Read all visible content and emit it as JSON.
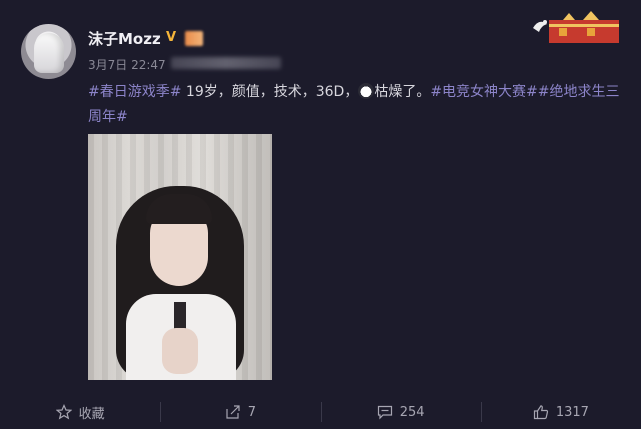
{
  "author": {
    "name": "沫子Mozz",
    "verified_icon": "vip-v-badge",
    "avatar_icon": "user-avatar"
  },
  "post_meta": {
    "time": "3月7日 22:47"
  },
  "post": {
    "segments": [
      {
        "type": "topic",
        "text": "#春日游戏季#"
      },
      {
        "type": "text",
        "text": " 19岁，颜值，技术，36D，"
      },
      {
        "type": "emoji",
        "text": ""
      },
      {
        "type": "text",
        "text": "枯燥了。"
      },
      {
        "type": "topic",
        "text": "#电竞女神大赛#"
      },
      {
        "type": "topic",
        "text": "#绝地求生三周年#"
      }
    ]
  },
  "actions": {
    "favorite": {
      "label": "收藏",
      "icon": "star-icon"
    },
    "repost": {
      "label": "7",
      "icon": "repost-icon"
    },
    "comment": {
      "label": "254",
      "icon": "comment-icon"
    },
    "like": {
      "label": "1317",
      "icon": "thumbs-up-icon"
    }
  },
  "colors": {
    "background": "#1c1b2b",
    "topic": "#8c84c9",
    "text": "#d8d7de",
    "meta": "#8a8996"
  }
}
